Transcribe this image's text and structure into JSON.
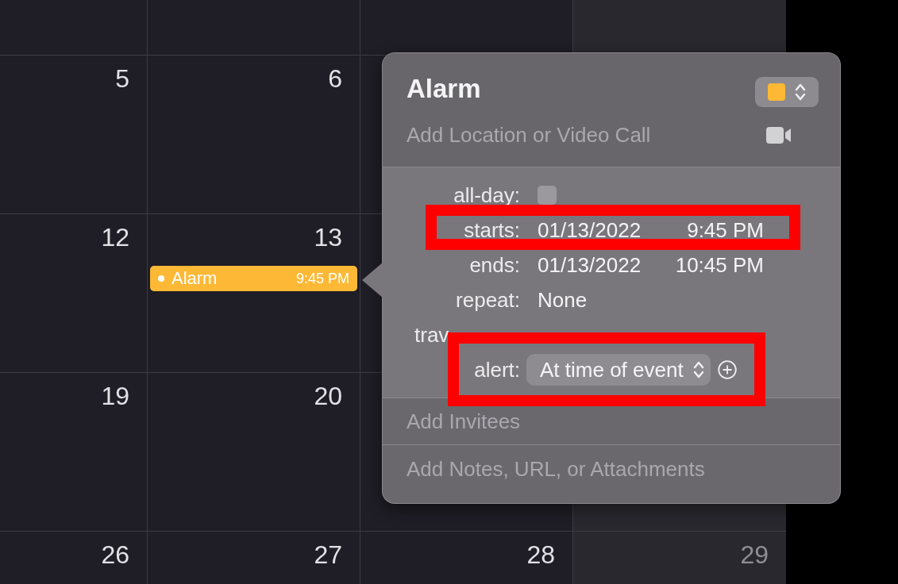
{
  "calendar": {
    "columns": [
      {
        "weekend": false
      },
      {
        "weekend": false
      },
      {
        "weekend": false
      },
      {
        "weekend": true
      }
    ],
    "weeks": [
      {
        "days": [
          {
            "number": "5"
          },
          {
            "number": "6"
          }
        ]
      },
      {
        "days": [
          {
            "number": "12"
          },
          {
            "number": "13",
            "events": [
              {
                "title": "Alarm",
                "time": "9:45 PM",
                "color": "#fdb935",
                "selected": true
              }
            ]
          }
        ]
      },
      {
        "days": [
          {
            "number": "19"
          },
          {
            "number": "20"
          }
        ]
      },
      {
        "days": [
          {
            "number": "26"
          },
          {
            "number": "27"
          },
          {
            "number": "28"
          },
          {
            "number": "29"
          }
        ]
      }
    ]
  },
  "event_popover": {
    "title": "Alarm",
    "color": "#fdb935",
    "location_placeholder": "Add Location or Video Call",
    "fields": [
      {
        "kind": "checkbox",
        "label": "all-day:",
        "checked": false,
        "highlighted": false
      },
      {
        "kind": "datetime",
        "label": "starts:",
        "date": "01/13/2022",
        "time": "9:45 PM",
        "highlighted": true
      },
      {
        "kind": "datetime",
        "label": "ends:",
        "date": "01/13/2022",
        "time": "10:45 PM",
        "highlighted": false
      },
      {
        "kind": "text",
        "label": "repeat:",
        "value": "None",
        "highlighted": false
      },
      {
        "kind": "cut",
        "label": "trav",
        "highlighted": false
      },
      {
        "kind": "popup",
        "label": "alert:",
        "value": "At time of event",
        "highlighted": true
      }
    ],
    "invitees_placeholder": "Add Invitees",
    "notes_placeholder": "Add Notes, URL, or Attachments"
  }
}
